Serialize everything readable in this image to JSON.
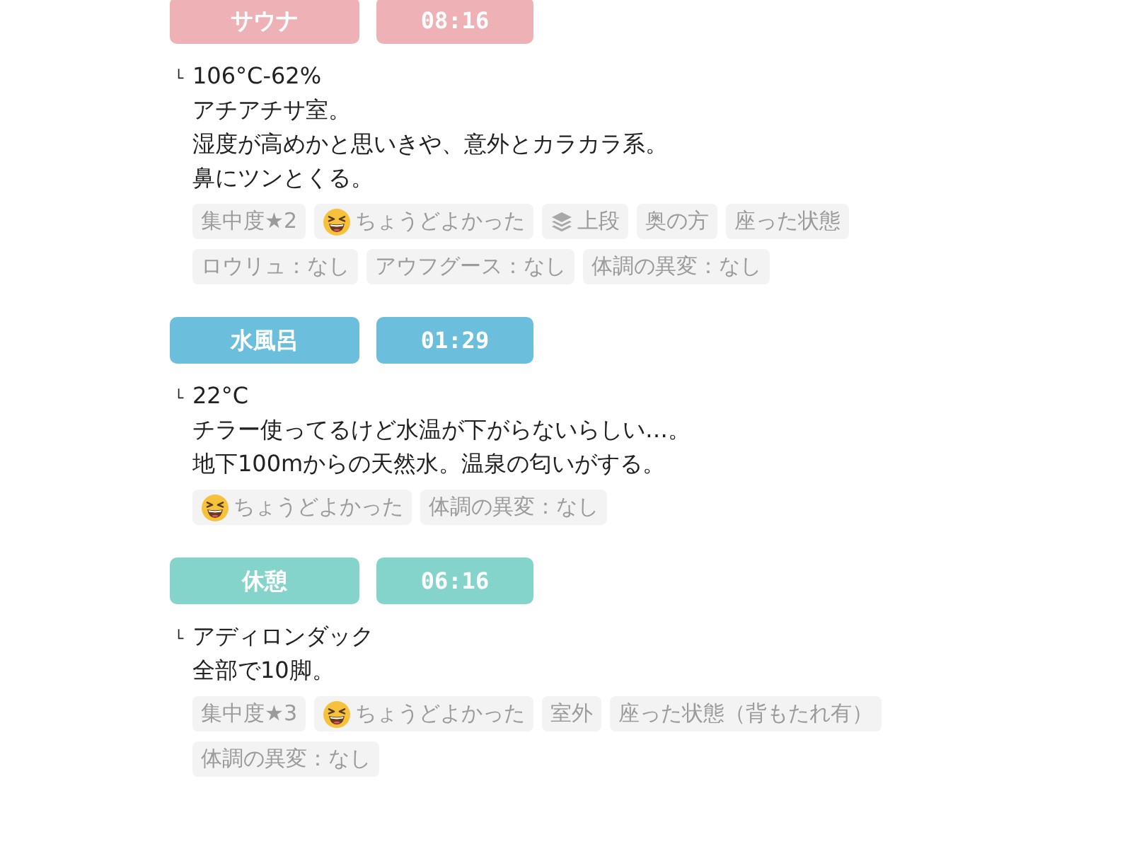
{
  "sections": [
    {
      "label": "サウナ",
      "time": "08:16",
      "color": "#eeb1b5",
      "marker": "└",
      "lines": [
        "106°C-62%",
        "アチアチサ室。",
        "湿度が高めかと思いきや、意外とカラカラ系。",
        "鼻にツンとくる。"
      ],
      "tag_rows": [
        [
          {
            "kind": "text",
            "text": "集中度★2"
          },
          {
            "kind": "emoji",
            "text": "ちょうどよかった"
          },
          {
            "kind": "layer",
            "text": "上段"
          },
          {
            "kind": "text",
            "text": "奥の方"
          },
          {
            "kind": "text",
            "text": "座った状態"
          }
        ],
        [
          {
            "kind": "text",
            "text": "ロウリュ：なし"
          },
          {
            "kind": "text",
            "text": "アウフグース：なし"
          },
          {
            "kind": "text",
            "text": "体調の異変：なし"
          }
        ]
      ]
    },
    {
      "label": "水風呂",
      "time": "01:29",
      "color": "#6bbfdd",
      "marker": "└",
      "lines": [
        "22°C",
        "チラー使ってるけど水温が下がらないらしい…。",
        "地下100mからの天然水。温泉の匂いがする。"
      ],
      "tag_rows": [
        [
          {
            "kind": "emoji",
            "text": "ちょうどよかった"
          },
          {
            "kind": "text",
            "text": "体調の異変：なし"
          }
        ]
      ]
    },
    {
      "label": "休憩",
      "time": "06:16",
      "color": "#85d4cc",
      "marker": "└",
      "lines": [
        "アディロンダック",
        "全部で10脚。"
      ],
      "tag_rows": [
        [
          {
            "kind": "text",
            "text": "集中度★3"
          },
          {
            "kind": "emoji",
            "text": "ちょうどよかった"
          },
          {
            "kind": "text",
            "text": "室外"
          },
          {
            "kind": "text",
            "text": "座った状態（背もたれ有）"
          }
        ],
        [
          {
            "kind": "text",
            "text": "体調の異変：なし"
          }
        ]
      ]
    }
  ]
}
